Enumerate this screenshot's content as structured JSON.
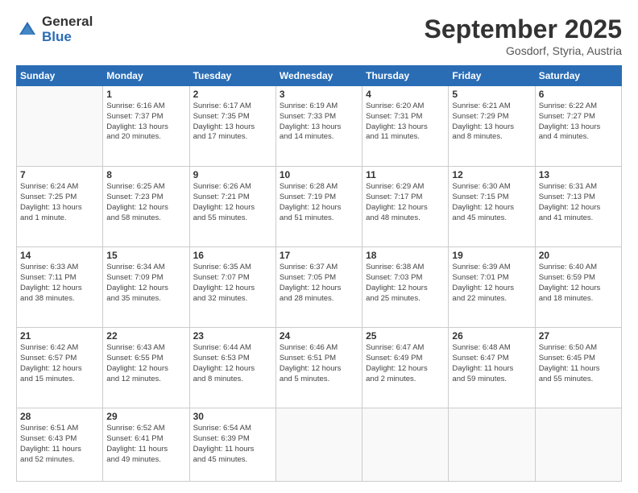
{
  "logo": {
    "general": "General",
    "blue": "Blue"
  },
  "header": {
    "month": "September 2025",
    "location": "Gosdorf, Styria, Austria"
  },
  "weekdays": [
    "Sunday",
    "Monday",
    "Tuesday",
    "Wednesday",
    "Thursday",
    "Friday",
    "Saturday"
  ],
  "weeks": [
    [
      {
        "day": "",
        "info": ""
      },
      {
        "day": "1",
        "info": "Sunrise: 6:16 AM\nSunset: 7:37 PM\nDaylight: 13 hours\nand 20 minutes."
      },
      {
        "day": "2",
        "info": "Sunrise: 6:17 AM\nSunset: 7:35 PM\nDaylight: 13 hours\nand 17 minutes."
      },
      {
        "day": "3",
        "info": "Sunrise: 6:19 AM\nSunset: 7:33 PM\nDaylight: 13 hours\nand 14 minutes."
      },
      {
        "day": "4",
        "info": "Sunrise: 6:20 AM\nSunset: 7:31 PM\nDaylight: 13 hours\nand 11 minutes."
      },
      {
        "day": "5",
        "info": "Sunrise: 6:21 AM\nSunset: 7:29 PM\nDaylight: 13 hours\nand 8 minutes."
      },
      {
        "day": "6",
        "info": "Sunrise: 6:22 AM\nSunset: 7:27 PM\nDaylight: 13 hours\nand 4 minutes."
      }
    ],
    [
      {
        "day": "7",
        "info": "Sunrise: 6:24 AM\nSunset: 7:25 PM\nDaylight: 13 hours\nand 1 minute."
      },
      {
        "day": "8",
        "info": "Sunrise: 6:25 AM\nSunset: 7:23 PM\nDaylight: 12 hours\nand 58 minutes."
      },
      {
        "day": "9",
        "info": "Sunrise: 6:26 AM\nSunset: 7:21 PM\nDaylight: 12 hours\nand 55 minutes."
      },
      {
        "day": "10",
        "info": "Sunrise: 6:28 AM\nSunset: 7:19 PM\nDaylight: 12 hours\nand 51 minutes."
      },
      {
        "day": "11",
        "info": "Sunrise: 6:29 AM\nSunset: 7:17 PM\nDaylight: 12 hours\nand 48 minutes."
      },
      {
        "day": "12",
        "info": "Sunrise: 6:30 AM\nSunset: 7:15 PM\nDaylight: 12 hours\nand 45 minutes."
      },
      {
        "day": "13",
        "info": "Sunrise: 6:31 AM\nSunset: 7:13 PM\nDaylight: 12 hours\nand 41 minutes."
      }
    ],
    [
      {
        "day": "14",
        "info": "Sunrise: 6:33 AM\nSunset: 7:11 PM\nDaylight: 12 hours\nand 38 minutes."
      },
      {
        "day": "15",
        "info": "Sunrise: 6:34 AM\nSunset: 7:09 PM\nDaylight: 12 hours\nand 35 minutes."
      },
      {
        "day": "16",
        "info": "Sunrise: 6:35 AM\nSunset: 7:07 PM\nDaylight: 12 hours\nand 32 minutes."
      },
      {
        "day": "17",
        "info": "Sunrise: 6:37 AM\nSunset: 7:05 PM\nDaylight: 12 hours\nand 28 minutes."
      },
      {
        "day": "18",
        "info": "Sunrise: 6:38 AM\nSunset: 7:03 PM\nDaylight: 12 hours\nand 25 minutes."
      },
      {
        "day": "19",
        "info": "Sunrise: 6:39 AM\nSunset: 7:01 PM\nDaylight: 12 hours\nand 22 minutes."
      },
      {
        "day": "20",
        "info": "Sunrise: 6:40 AM\nSunset: 6:59 PM\nDaylight: 12 hours\nand 18 minutes."
      }
    ],
    [
      {
        "day": "21",
        "info": "Sunrise: 6:42 AM\nSunset: 6:57 PM\nDaylight: 12 hours\nand 15 minutes."
      },
      {
        "day": "22",
        "info": "Sunrise: 6:43 AM\nSunset: 6:55 PM\nDaylight: 12 hours\nand 12 minutes."
      },
      {
        "day": "23",
        "info": "Sunrise: 6:44 AM\nSunset: 6:53 PM\nDaylight: 12 hours\nand 8 minutes."
      },
      {
        "day": "24",
        "info": "Sunrise: 6:46 AM\nSunset: 6:51 PM\nDaylight: 12 hours\nand 5 minutes."
      },
      {
        "day": "25",
        "info": "Sunrise: 6:47 AM\nSunset: 6:49 PM\nDaylight: 12 hours\nand 2 minutes."
      },
      {
        "day": "26",
        "info": "Sunrise: 6:48 AM\nSunset: 6:47 PM\nDaylight: 11 hours\nand 59 minutes."
      },
      {
        "day": "27",
        "info": "Sunrise: 6:50 AM\nSunset: 6:45 PM\nDaylight: 11 hours\nand 55 minutes."
      }
    ],
    [
      {
        "day": "28",
        "info": "Sunrise: 6:51 AM\nSunset: 6:43 PM\nDaylight: 11 hours\nand 52 minutes."
      },
      {
        "day": "29",
        "info": "Sunrise: 6:52 AM\nSunset: 6:41 PM\nDaylight: 11 hours\nand 49 minutes."
      },
      {
        "day": "30",
        "info": "Sunrise: 6:54 AM\nSunset: 6:39 PM\nDaylight: 11 hours\nand 45 minutes."
      },
      {
        "day": "",
        "info": ""
      },
      {
        "day": "",
        "info": ""
      },
      {
        "day": "",
        "info": ""
      },
      {
        "day": "",
        "info": ""
      }
    ]
  ]
}
